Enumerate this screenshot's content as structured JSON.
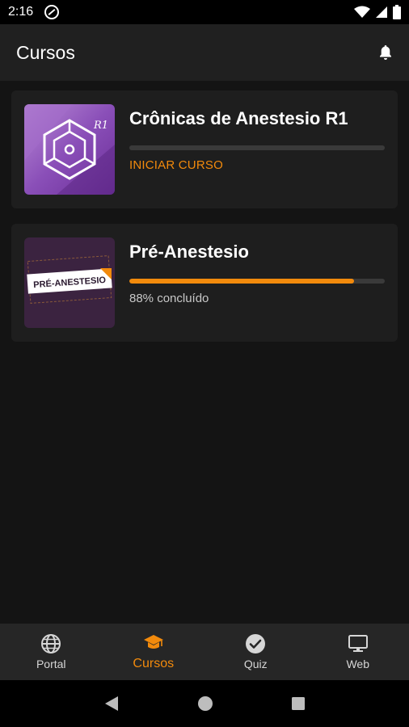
{
  "status_bar": {
    "time": "2:16"
  },
  "app_bar": {
    "title": "Cursos"
  },
  "courses": [
    {
      "title": "Crônicas de Anestesio R1",
      "progress": 0,
      "action_label": "INICIAR CURSO",
      "thumbnail_mark": "R1"
    },
    {
      "title": "Pré-Anestesio",
      "progress": 0.88,
      "status_label": "88% concluído",
      "thumbnail_text": "PRÉ-ANESTESIO"
    }
  ],
  "bottom_nav": {
    "items": [
      {
        "label": "Portal",
        "icon": "globe-icon",
        "active": false
      },
      {
        "label": "Cursos",
        "icon": "graduation-cap-icon",
        "active": true
      },
      {
        "label": "Quiz",
        "icon": "check-circle-icon",
        "active": false
      },
      {
        "label": "Web",
        "icon": "monitor-icon",
        "active": false
      }
    ]
  },
  "colors": {
    "accent": "#f28a0c",
    "background": "#141414",
    "card": "#1e1e1e",
    "app_bar": "#202020",
    "nav_bar": "#262626"
  }
}
